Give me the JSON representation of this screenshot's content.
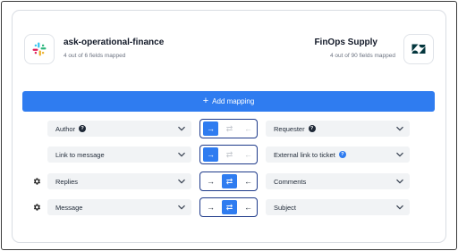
{
  "source": {
    "name": "ask-operational-finance",
    "fields_mapped": "4 out of 6 fields mapped",
    "icon": "slack-logo-icon"
  },
  "target": {
    "name": "FinOps Supply",
    "fields_mapped": "4 out of 90 fields mapped",
    "icon": "zendesk-logo-icon"
  },
  "add_mapping": {
    "plus": "+",
    "label": "Add mapping"
  },
  "direction_glyphs": {
    "to_target": "→",
    "both": "⇄",
    "to_source": "←"
  },
  "mappings": [
    {
      "source_field": "Author",
      "source_help": true,
      "target_field": "Requester",
      "target_help": true,
      "has_settings": false,
      "direction": "to_target",
      "enabled": [
        "to_target"
      ]
    },
    {
      "source_field": "Link to message",
      "source_help": false,
      "target_field": "External link to ticket",
      "target_help": true,
      "has_settings": false,
      "direction": "to_target",
      "enabled": [
        "to_target"
      ]
    },
    {
      "source_field": "Replies",
      "source_help": false,
      "target_field": "Comments",
      "target_help": false,
      "has_settings": true,
      "direction": "both",
      "enabled": [
        "to_target",
        "both",
        "to_source"
      ]
    },
    {
      "source_field": "Message",
      "source_help": false,
      "target_field": "Subject",
      "target_help": false,
      "has_settings": true,
      "direction": "both",
      "enabled": [
        "to_target",
        "both",
        "to_source"
      ]
    }
  ],
  "colors": {
    "accent": "#2f7cf0",
    "help_dark": "#1f2937",
    "help_blue": "#2f7cf0",
    "direction_border": "#1e3a8a"
  }
}
